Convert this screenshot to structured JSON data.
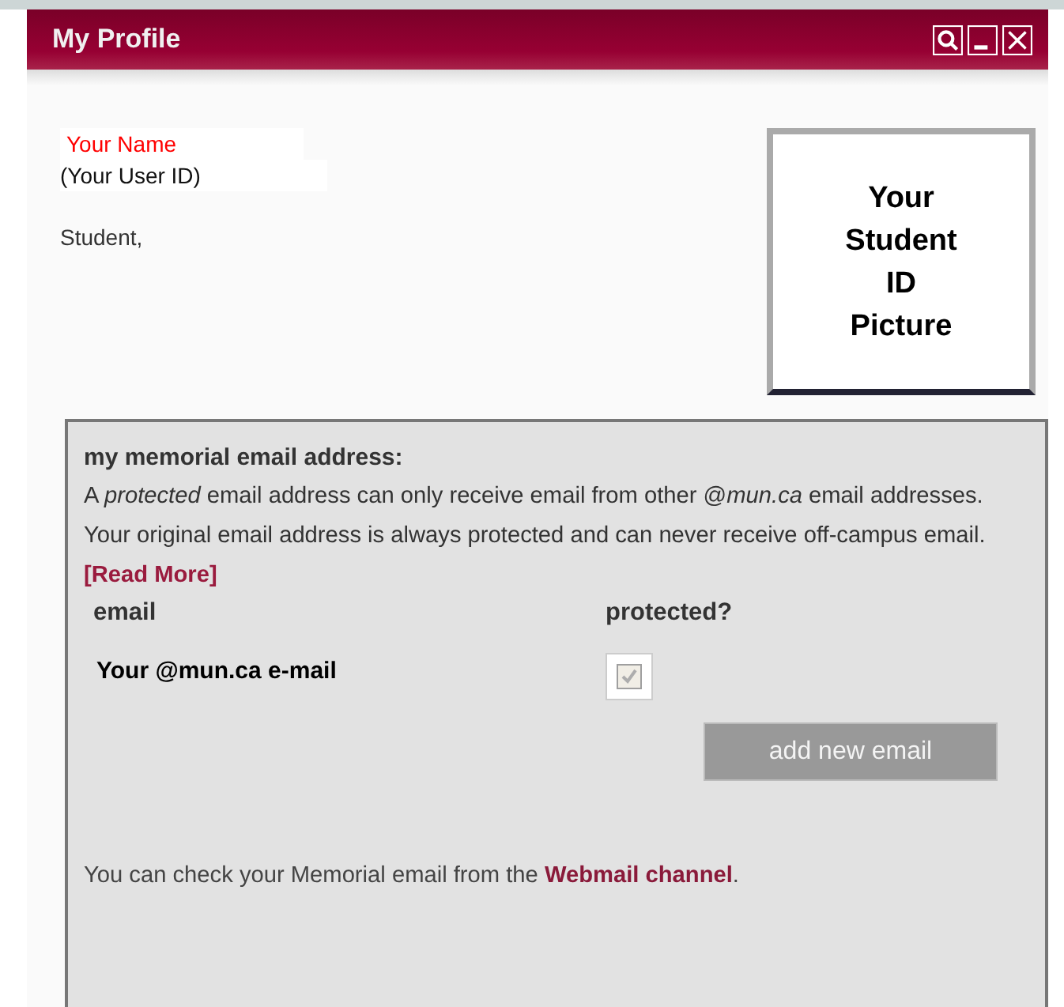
{
  "window": {
    "title": "My Profile",
    "controls": [
      {
        "kind": "search"
      },
      {
        "kind": "minimize"
      },
      {
        "kind": "close"
      }
    ]
  },
  "profile": {
    "name": "Your Name",
    "user_id": "(Your User ID)",
    "role": "Student,",
    "photo_caption": [
      "Your",
      "Student",
      "ID",
      "Picture"
    ]
  },
  "email_section": {
    "heading": "my memorial email address:",
    "description": "A *protected* email address can only receive email from other @*mun.ca* email addresses. Your original email address is always protected and can never receive off-campus email.",
    "read_more": "[Read More]",
    "columns": [
      "email",
      "protected?"
    ],
    "rows": [
      {
        "email": "Your @mun.ca e-mail",
        "protected": true,
        "disabled": true
      }
    ],
    "add_button": "add new email",
    "footer": {
      "before": "You can check your Memorial email from the ",
      "link": "Webmail channel",
      "after": "."
    }
  }
}
